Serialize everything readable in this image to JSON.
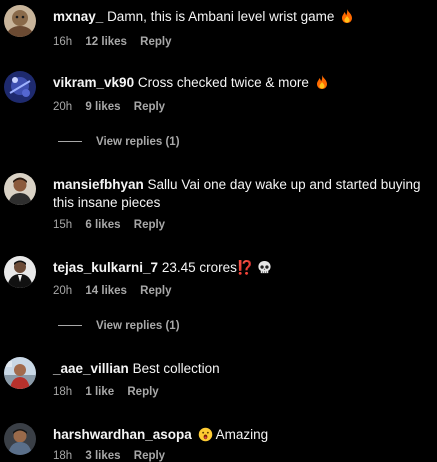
{
  "comments": [
    {
      "username": "mxnay_",
      "text": "Damn, this is Ambani level wrist game",
      "emoji": "fire",
      "time": "16h",
      "likes": "12 likes",
      "reply": "Reply"
    },
    {
      "username": "vikram_vk90",
      "text": "Cross checked twice & more",
      "emoji": "fire",
      "time": "20h",
      "likes": "9 likes",
      "reply": "Reply",
      "view_replies": "View replies (1)"
    },
    {
      "username": "mansiefbhyan",
      "text": "Sallu Vai one day wake up and started buying this insane pieces",
      "time": "15h",
      "likes": "6 likes",
      "reply": "Reply"
    },
    {
      "username": "tejas_kulkarni_7",
      "text": "23.45 crores⁉️",
      "emoji": "skull",
      "time": "20h",
      "likes": "14 likes",
      "reply": "Reply",
      "view_replies": "View replies (1)"
    },
    {
      "username": "_aae_villian",
      "text": "Best collection",
      "time": "18h",
      "likes": "1 like",
      "reply": "Reply"
    },
    {
      "username": "harshwardhan_asopa",
      "text": "Amazing",
      "emoji_prefix": "surprised-face",
      "time": "18h",
      "likes": "3 likes",
      "reply": "Reply"
    }
  ],
  "colors": {
    "background": "#000000",
    "text": "#f5f5f5",
    "secondary": "#a8a8a8",
    "fire": "#ff6a00"
  }
}
